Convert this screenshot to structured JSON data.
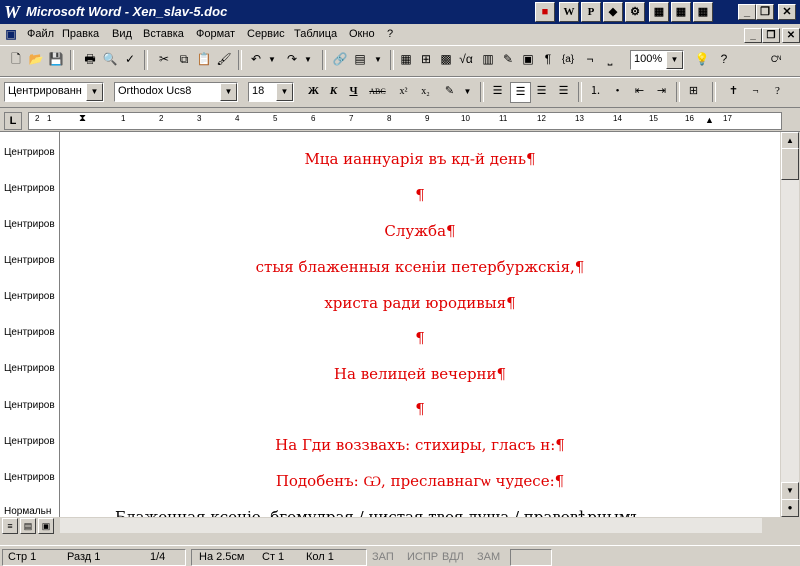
{
  "titlebar": {
    "app_name": "Microsoft Word",
    "title": "Microsoft Word - Xen_slav-5.doc",
    "quick_icons": [
      "W",
      "P",
      "◆",
      "⚙",
      "▦",
      "▦",
      "▦"
    ]
  },
  "menu": {
    "items": [
      "Файл",
      "Правка",
      "Вид",
      "Вставка",
      "Формат",
      "Сервис",
      "Таблица",
      "Окно",
      "?"
    ]
  },
  "standard_toolbar": {
    "zoom": "100%"
  },
  "format_toolbar": {
    "style": "Центрированн",
    "font": "Orthodox Ucs8",
    "size": "18",
    "bold": "Ж",
    "italic": "К",
    "underline": "Ч",
    "strike": "АВС",
    "superscript": "x²",
    "subscript": "x₂"
  },
  "ruler": {
    "labels": [
      "1",
      "2",
      "1",
      "2",
      "3",
      "4",
      "5",
      "6",
      "7",
      "8",
      "9",
      "10",
      "11",
      "12",
      "13",
      "14",
      "15",
      "16",
      "17"
    ]
  },
  "style_area": {
    "labels": [
      "Центриров",
      "Центриров",
      "Центриров",
      "Центриров",
      "Центриров",
      "Центриров",
      "Центриров",
      "Центриров",
      "Центриров",
      "Центриров",
      "Нормальн"
    ]
  },
  "document": {
    "paragraphs": [
      "Мца ианнуарія въ кд-й день¶",
      "¶",
      "Служба¶",
      "стыя блаженныя ксеніи петербуржскія,¶",
      "христа ради юродивыя¶",
      "¶",
      "На велицей вечерни¶",
      "¶",
      "На Гди воззвахъ: стихиры, гласъ н:¶",
      "Подобенъ: Ѡ, преславнагѡ чудесе:¶",
      "Блаженная ксеніе, бгомудрая,/ чистая твоя душа,/ правовѣрнымъ"
    ]
  },
  "colors": {
    "accent_red": "#e00000",
    "titlebar": "#0a246a"
  },
  "status": {
    "page": "Стр 1",
    "section": "Разд 1",
    "pages": "1/4",
    "at": "На 2.5см",
    "line": "Ст 1",
    "col": "Кол 1",
    "rec": "ЗАП",
    "trk": "ИСПР",
    "ext": "ВДЛ",
    "ovr": "ЗАМ"
  }
}
